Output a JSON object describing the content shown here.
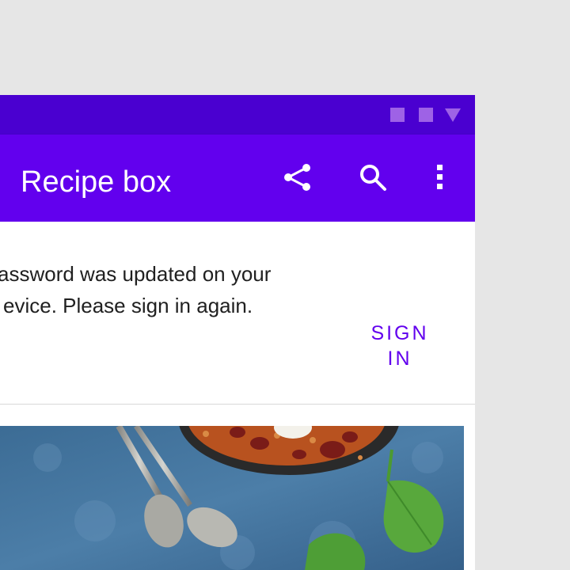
{
  "colors": {
    "status_bar": "#4a00d0",
    "app_bar": "#6200ee",
    "accent": "#6200ee",
    "background": "#e6e6e6",
    "surface": "#ffffff"
  },
  "status_bar": {
    "icons": [
      "square-icon",
      "square-icon",
      "signal-triangle-icon"
    ]
  },
  "app_bar": {
    "title": "Recipe box",
    "actions": [
      "share-icon",
      "search-icon",
      "more-vert-icon"
    ]
  },
  "banner": {
    "message_line1": "assword was updated on your",
    "message_line2": "evice. Please sign in again.",
    "action_label": "SIGN IN",
    "dismiss_icon": "close-icon"
  },
  "card": {
    "image": "recipe-photo-image"
  }
}
